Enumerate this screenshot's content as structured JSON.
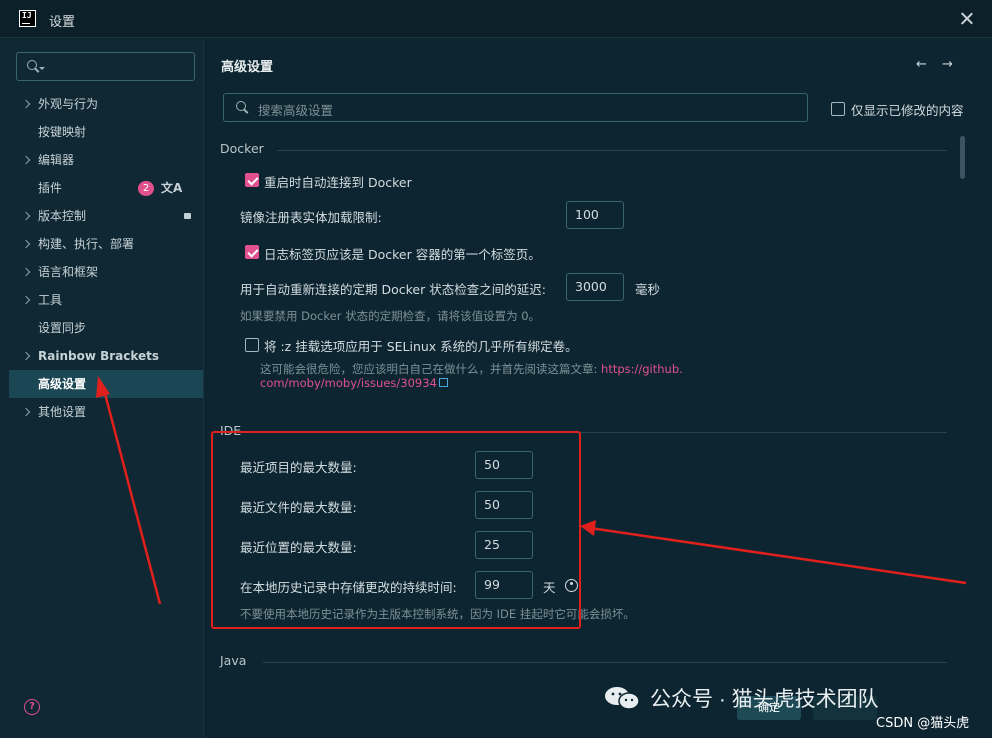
{
  "window": {
    "title": "设置"
  },
  "sidebar": {
    "search_placeholder": "",
    "items": [
      {
        "label": "外观与行为",
        "expandable": true
      },
      {
        "label": "按键映射",
        "expandable": false
      },
      {
        "label": "编辑器",
        "expandable": true
      },
      {
        "label": "插件",
        "expandable": false,
        "badge": "2",
        "icon": "translate-icon",
        "icon_text": "文A"
      },
      {
        "label": "版本控制",
        "expandable": true,
        "icon": "vcs-icon"
      },
      {
        "label": "构建、执行、部署",
        "expandable": true
      },
      {
        "label": "语言和框架",
        "expandable": true
      },
      {
        "label": "工具",
        "expandable": true
      },
      {
        "label": "设置同步",
        "expandable": false
      },
      {
        "label": "Rainbow Brackets",
        "expandable": true
      },
      {
        "label": "高级设置",
        "expandable": false,
        "active": true
      },
      {
        "label": "其他设置",
        "expandable": true
      }
    ],
    "help_icon": "?"
  },
  "main": {
    "title": "高级设置",
    "nav": {
      "back": "←",
      "forward": "→"
    },
    "search": {
      "placeholder": "搜索高级设置"
    },
    "modified_only": {
      "label": "仅显示已修改的内容",
      "checked": false
    },
    "docker": {
      "title": "Docker",
      "reconnect": {
        "label": "重启时自动连接到 Docker",
        "checked": true
      },
      "registry_limit": {
        "label": "镜像注册表实体加载限制:",
        "value": "100"
      },
      "log_tab_first": {
        "label": "日志标签页应该是 Docker 容器的第一个标签页。",
        "checked": true
      },
      "reconnect_delay": {
        "label": "用于自动重新连接的定期 Docker 状态检查之间的延迟:",
        "value": "3000",
        "unit": "毫秒"
      },
      "reconnect_hint": "如果要禁用 Docker 状态的定期检查，请将该值设置为 0。",
      "selinux": {
        "label": "将 :z 挂载选项应用于 SELinux 系统的几乎所有绑定卷。",
        "checked": false
      },
      "selinux_hint_1": "这可能会很危险，您应该明白自己在做什么，并首先阅读这篇文章: ",
      "selinux_link_1": "https://github.",
      "selinux_link_2": "com/moby/moby/issues/30934"
    },
    "ide": {
      "title": "IDE",
      "recent_projects": {
        "label": "最近项目的最大数量:",
        "value": "50"
      },
      "recent_files": {
        "label": "最近文件的最大数量:",
        "value": "50"
      },
      "recent_locations": {
        "label": "最近位置的最大数量:",
        "value": "25"
      },
      "history_days": {
        "label": "在本地历史记录中存储更改的持续时间:",
        "value": "99",
        "unit": "天"
      },
      "history_hint": "不要使用本地历史记录作为主版本控制系统，因为 IDE 挂起时它可能会损坏。"
    },
    "java": {
      "title": "Java"
    },
    "ok_button": "确定"
  },
  "overlay": {
    "watermark": "公众号 · 猫头虎技术团队",
    "credit": "CSDN @猫头虎",
    "highlight_color": "#e0201c"
  }
}
